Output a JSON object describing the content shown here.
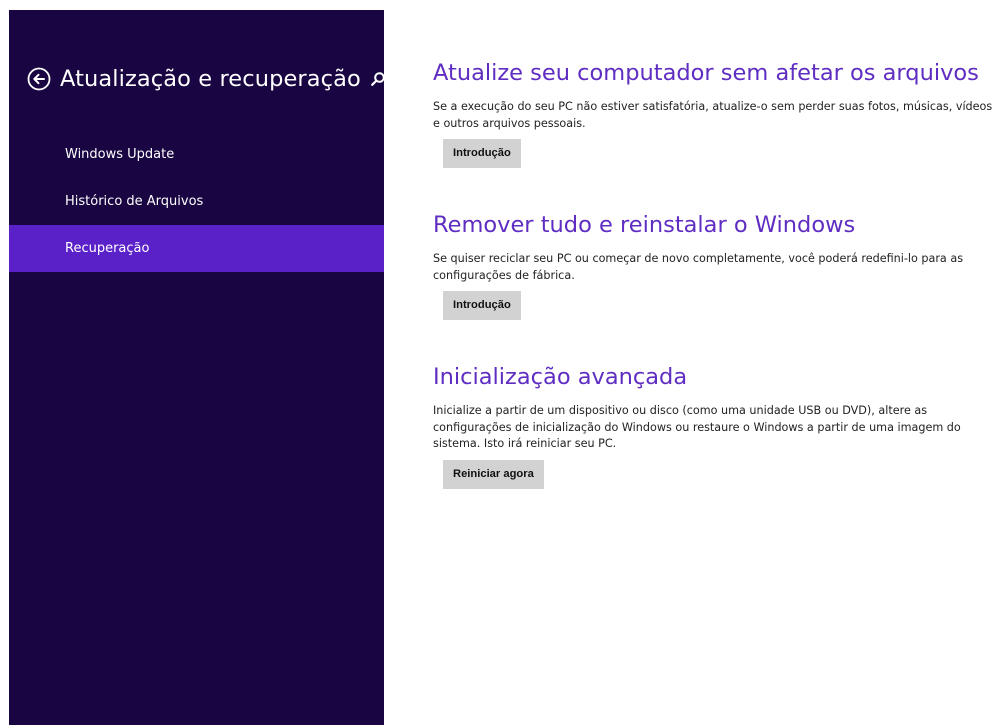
{
  "sidebar": {
    "title": "Atualização e recuperação",
    "back_icon": "back-arrow-icon",
    "search_icon": "search-icon",
    "items": [
      {
        "label": "Windows Update",
        "selected": false
      },
      {
        "label": "Histórico de Arquivos",
        "selected": false
      },
      {
        "label": "Recuperação",
        "selected": true
      }
    ]
  },
  "main": {
    "sections": [
      {
        "title": "Atualize seu computador sem afetar os arquivos",
        "description": "Se a execução do seu PC não estiver satisfatória, atualize-o sem perder suas fotos, músicas, vídeos e outros arquivos pessoais.",
        "button": "Introdução"
      },
      {
        "title": "Remover tudo e reinstalar o Windows",
        "description": "Se quiser reciclar seu PC ou começar de novo completamente, você poderá redefini-lo para as configurações de fábrica.",
        "button": "Introdução"
      },
      {
        "title": "Inicialização avançada",
        "description": "Inicialize a partir de um dispositivo ou disco (como uma unidade USB ou DVD), altere as configurações de inicialização do Windows ou restaure o Windows a partir de uma imagem do sistema. Isto irá reiniciar seu PC.",
        "button": "Reiniciar agora"
      }
    ]
  },
  "colors": {
    "sidebar_bg": "#180541",
    "selected_bg": "#5b21c9",
    "accent_title": "#5f2dc1",
    "button_bg": "#d2d2d2"
  }
}
